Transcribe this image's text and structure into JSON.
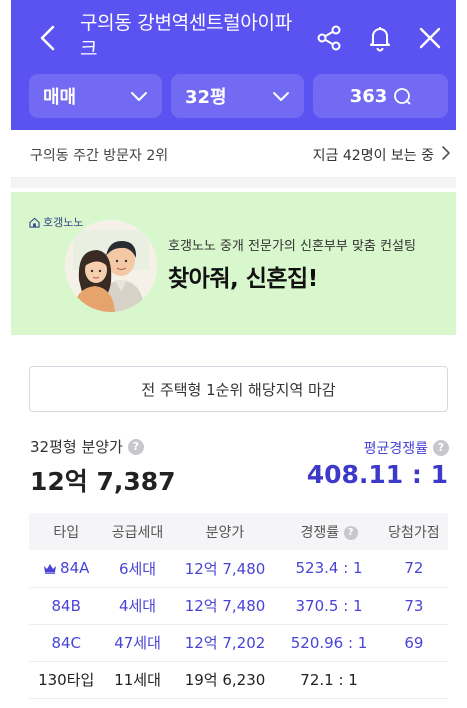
{
  "header": {
    "title": "구의동 강변역센트럴아이파크",
    "icons": [
      "back-icon",
      "share-icon",
      "bell-icon",
      "close-icon"
    ],
    "filters": [
      {
        "label": "매매"
      },
      {
        "label": "32평"
      },
      {
        "label": "363"
      }
    ],
    "accent": "#5b52f2"
  },
  "visit": {
    "rank_text": "구의동 주간 방문자 2위",
    "viewing_text": "지금 42명이 보는 중"
  },
  "banner": {
    "brand": "호갱노노",
    "subtitle": "호갱노노 중개 전문가의 신혼부부 맞춤 컨설팅",
    "headline": "찾아줘, 신혼집!",
    "background": "#d8f7cc"
  },
  "deadline_notice": "전 주택형 1순위 해당지역 마감",
  "summary": {
    "price_label": "32평형 분양가",
    "price_value": "12억 7,387",
    "competition_label": "평균경쟁률",
    "competition_value": "408.11 : 1"
  },
  "table": {
    "headers": [
      "타입",
      "공급세대",
      "분양가",
      "경쟁률",
      "당첨가점"
    ],
    "rows": [
      {
        "type": "84A",
        "supply": "6세대",
        "price": "12억 7,480",
        "ratio": "523.4 : 1",
        "score": "72"
      },
      {
        "type": "84B",
        "supply": "4세대",
        "price": "12억 7,480",
        "ratio": "370.5 : 1",
        "score": "73"
      },
      {
        "type": "84C",
        "supply": "47세대",
        "price": "12억 7,202",
        "ratio": "520.96 : 1",
        "score": "69"
      },
      {
        "type": "130타입",
        "supply": "11세대",
        "price": "19억 6,230",
        "ratio": "72.1 : 1",
        "score": ""
      }
    ]
  }
}
